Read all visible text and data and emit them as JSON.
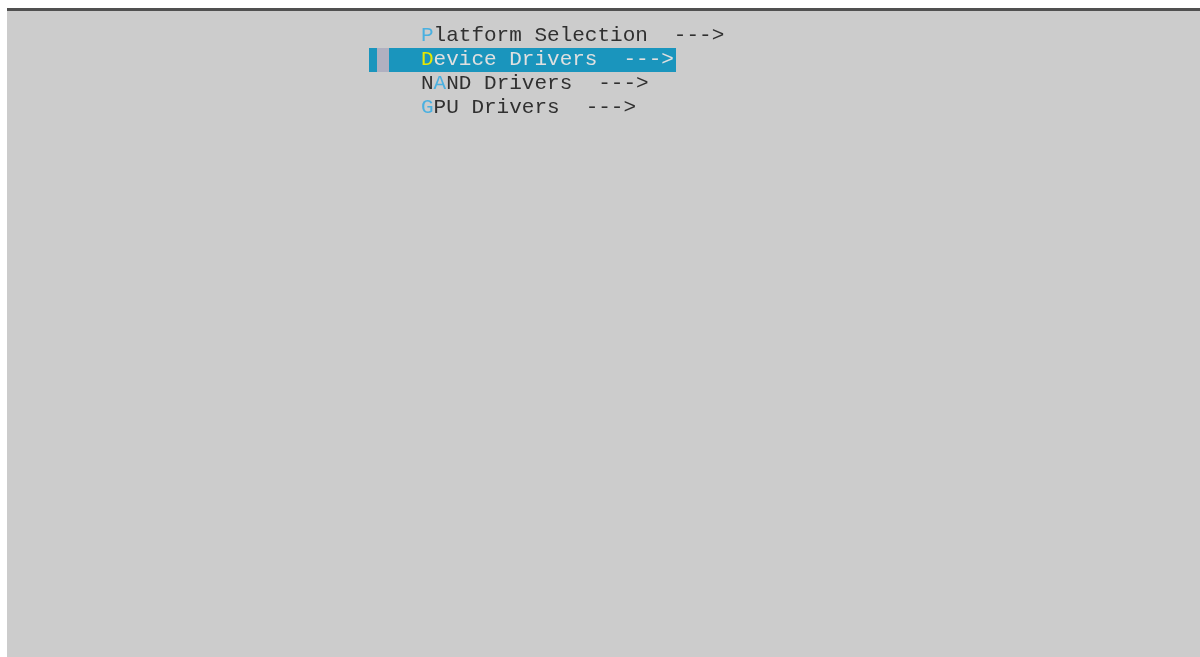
{
  "menu": [
    {
      "key": "P",
      "after": "latform Selection",
      "arrow": "--->",
      "selected": false
    },
    {
      "key": "D",
      "after": "evice Drivers",
      "arrow": "--->",
      "selected": true
    },
    {
      "before": "N",
      "key": "A",
      "after": "ND Drivers",
      "arrow": "--->",
      "selected": false
    },
    {
      "key": "G",
      "after": "PU Drivers",
      "arrow": "--->",
      "selected": false
    }
  ]
}
